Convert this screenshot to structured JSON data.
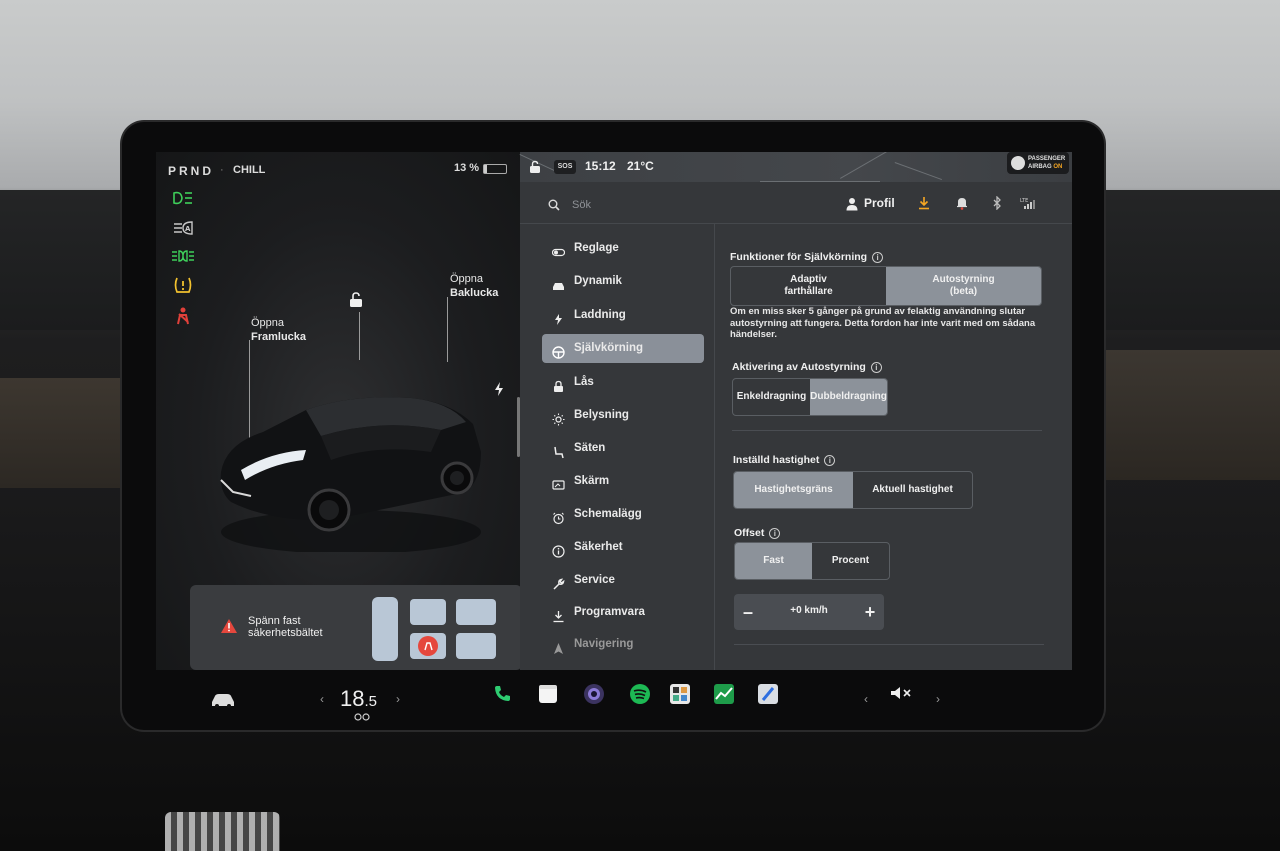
{
  "status": {
    "gears": "PRND",
    "drive_mode": "CHILL",
    "battery_percent": "13 %",
    "battery_level": 0.13,
    "time": "15:12",
    "outside_temp": "21°C",
    "sos_label": "SOS",
    "airbag_line1": "PASSENGER",
    "airbag_line2": "AIRBAG",
    "airbag_state": "ON"
  },
  "telltales": [
    {
      "icon": "headlights-icon",
      "color": "#3ecf5a"
    },
    {
      "icon": "auto-high-beam-icon",
      "color": "#c8c8c8"
    },
    {
      "icon": "parking-lights-icon",
      "color": "#3ecf5a"
    },
    {
      "icon": "tire-pressure-warning-icon",
      "color": "#f2c12e"
    },
    {
      "icon": "seatbelt-warning-icon",
      "color": "#e0403a"
    }
  ],
  "car_view": {
    "frunk_line1": "Öppna",
    "frunk_line2": "Framlucka",
    "trunk_line1": "Öppna",
    "trunk_line2": "Baklucka",
    "seatbelt_line1": "Spänn fast",
    "seatbelt_line2": "säkerhetsbältet"
  },
  "header": {
    "search_placeholder": "Sök",
    "profile_label": "Profil",
    "lte_label": "LTE"
  },
  "menu": {
    "items": [
      {
        "label": "Reglage",
        "icon": "toggle-icon",
        "active": false
      },
      {
        "label": "Dynamik",
        "icon": "car-icon",
        "active": false
      },
      {
        "label": "Laddning",
        "icon": "lightning-icon",
        "active": false
      },
      {
        "label": "Självkörning",
        "icon": "steering-wheel-icon",
        "active": true
      },
      {
        "label": "Lås",
        "icon": "lock-icon",
        "active": false
      },
      {
        "label": "Belysning",
        "icon": "sun-icon",
        "active": false
      },
      {
        "label": "Säten",
        "icon": "seat-icon",
        "active": false
      },
      {
        "label": "Skärm",
        "icon": "display-icon",
        "active": false
      },
      {
        "label": "Schemalägg",
        "icon": "alarm-clock-icon",
        "active": false
      },
      {
        "label": "Säkerhet",
        "icon": "info-circle-icon",
        "active": false
      },
      {
        "label": "Service",
        "icon": "wrench-icon",
        "active": false
      },
      {
        "label": "Programvara",
        "icon": "download-icon",
        "active": false
      },
      {
        "label": "Navigering",
        "icon": "navigation-icon",
        "active": false
      }
    ]
  },
  "autopilot": {
    "features_title": "Funktioner för Självkörning",
    "features_options": [
      {
        "line1": "Adaptiv",
        "line2": "farthållare",
        "selected": false
      },
      {
        "line1": "Autostyrning",
        "line2": "(beta)",
        "selected": true
      }
    ],
    "strike_note": "Om en miss sker 5 gånger på grund av felaktig användning slutar autostyrning att fungera. Detta fordon har inte varit med om sådana händelser.",
    "activation_title": "Aktivering av Autostyrning",
    "activation_options": [
      {
        "label": "Enkeldragning",
        "selected": false
      },
      {
        "label": "Dubbeldragning",
        "selected": true
      }
    ],
    "speed_title": "Inställd hastighet",
    "speed_options": [
      {
        "label": "Hastighetsgräns",
        "selected": true
      },
      {
        "label": "Aktuell hastighet",
        "selected": false
      }
    ],
    "offset_title": "Offset",
    "offset_options": [
      {
        "label": "Fast",
        "selected": true
      },
      {
        "label": "Procent",
        "selected": false
      }
    ],
    "offset_minus": "–",
    "offset_value": "+0 km/h",
    "offset_plus": "+"
  },
  "bottom": {
    "cabin_temp_int": "18",
    "cabin_temp_dec": ".5",
    "chevron_left": "‹",
    "chevron_right": "›",
    "dock_apps": [
      {
        "icon": "phone-icon",
        "color": "#2a2c2e"
      },
      {
        "icon": "notes-icon",
        "color": "#f4f4f4"
      },
      {
        "icon": "camera-icon",
        "color": "#3b3360"
      },
      {
        "icon": "spotify-icon",
        "color": "#1db954"
      },
      {
        "icon": "toybox-icon",
        "color": "#e8e8e8"
      },
      {
        "icon": "energy-icon",
        "color": "#1e9c4a"
      },
      {
        "icon": "navigation-app-icon",
        "color": "#d9dde3"
      }
    ]
  }
}
